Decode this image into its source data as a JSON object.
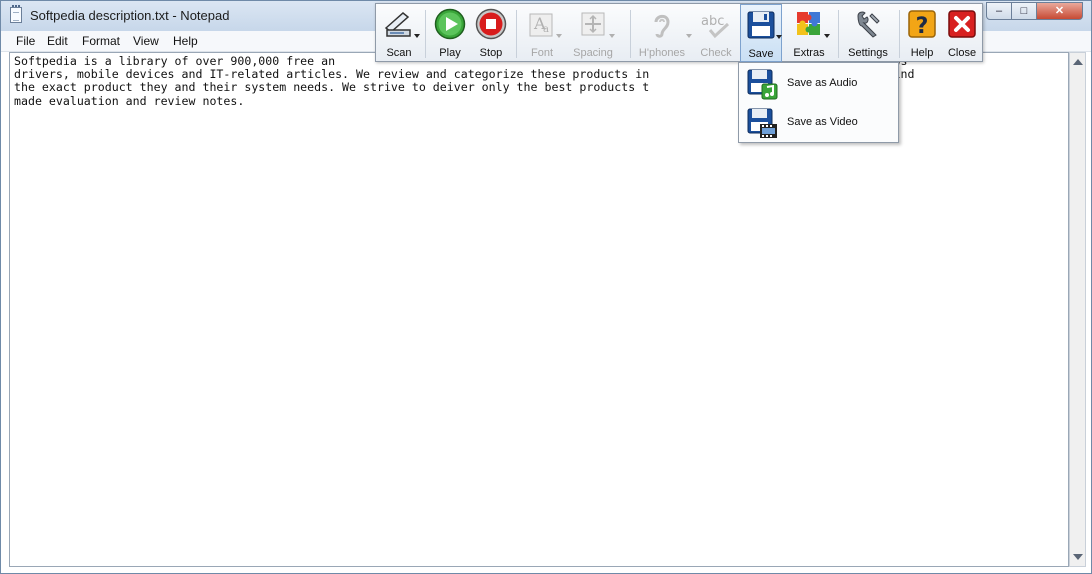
{
  "window": {
    "title": "Softpedia description.txt - Notepad",
    "controls": {
      "minimize": "–",
      "maximize": "□",
      "close": "✕"
    }
  },
  "menubar": {
    "items": [
      {
        "label": "File"
      },
      {
        "label": "Edit"
      },
      {
        "label": "Format"
      },
      {
        "label": "View"
      },
      {
        "label": "Help"
      }
    ]
  },
  "editor": {
    "text": "Softpedia is a library of over 900,000 free an                                                                         , Windows\ndrivers, mobile devices and IT-related articles. We review and categorize these products in                  visitor/user to find\nthe exact product they and their system needs. We strive to deiver only the best products t                 ogether with self-\nmade evaluation and review notes."
  },
  "toolbar": {
    "buttons": [
      {
        "key": "scan",
        "label": "Scan",
        "enabled": true
      },
      {
        "key": "play",
        "label": "Play",
        "enabled": true
      },
      {
        "key": "stop",
        "label": "Stop",
        "enabled": true
      },
      {
        "key": "font",
        "label": "Font",
        "enabled": false
      },
      {
        "key": "spacing",
        "label": "Spacing",
        "enabled": false
      },
      {
        "key": "hphones",
        "label": "H'phones",
        "enabled": false
      },
      {
        "key": "check",
        "label": "Check",
        "enabled": false
      },
      {
        "key": "save",
        "label": "Save",
        "enabled": true
      },
      {
        "key": "extras",
        "label": "Extras",
        "enabled": true
      },
      {
        "key": "settings",
        "label": "Settings",
        "enabled": true
      },
      {
        "key": "help",
        "label": "Help",
        "enabled": true
      },
      {
        "key": "close",
        "label": "Close",
        "enabled": true
      }
    ],
    "check_icon_text": "abc",
    "help_icon_text": "?",
    "close_icon_text": "✕"
  },
  "save_menu": {
    "items": [
      {
        "label": "Save as Audio"
      },
      {
        "label": "Save as Video"
      }
    ]
  },
  "colors": {
    "titlebar": "#c7d7ea",
    "play_green": "#2e9a2e",
    "stop_red": "#d01818",
    "close_red": "#d82020",
    "help_orange": "#f2a516",
    "save_blue": "#1b4f9c"
  }
}
